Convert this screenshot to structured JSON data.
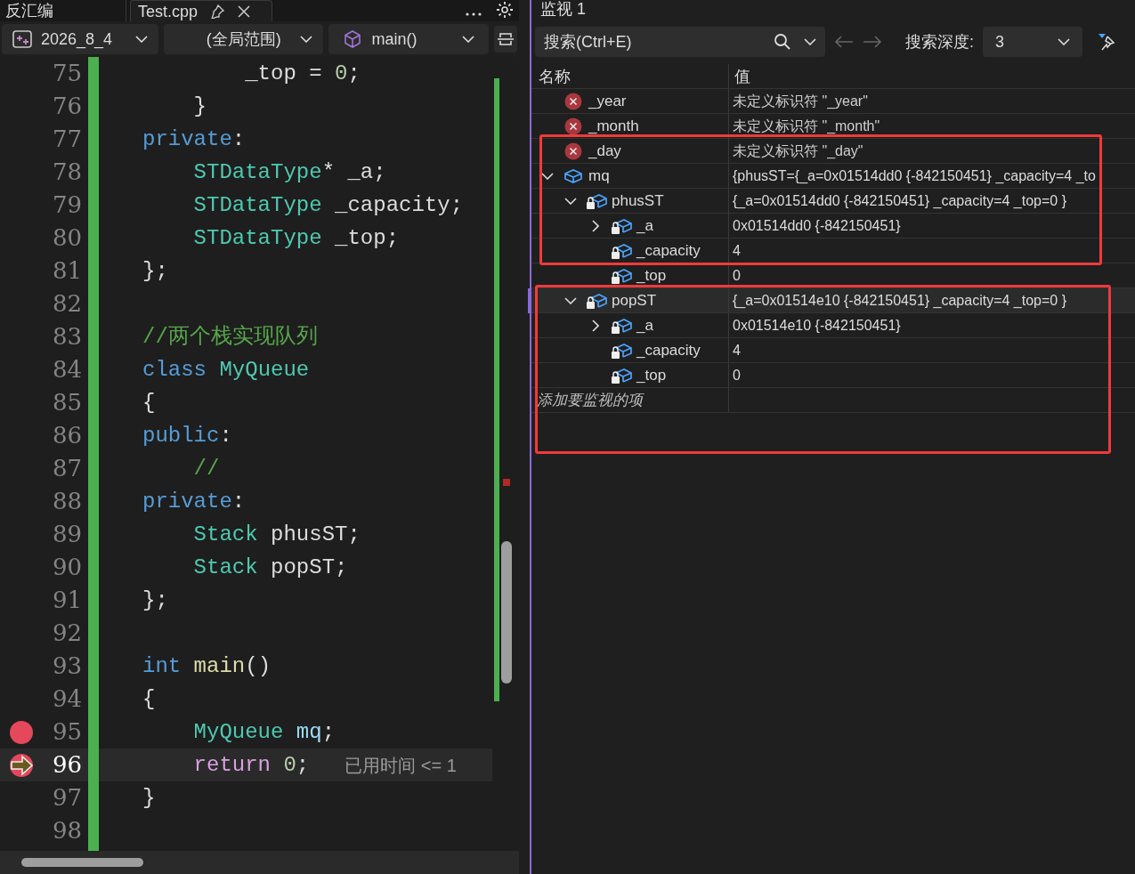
{
  "editor": {
    "tabs": [
      {
        "label": "反汇编",
        "selected": false
      },
      {
        "label": "Test.cpp",
        "selected": true,
        "pinned": true
      }
    ],
    "project": "2026_8_4",
    "scope": "(全局范围)",
    "member": "main()",
    "lines": [
      {
        "number": "75",
        "tokens": [
          {
            "kind": "plain",
            "text": "        _top = "
          },
          {
            "kind": "number",
            "text": "0"
          },
          {
            "kind": "plain",
            "text": ";"
          }
        ]
      },
      {
        "number": "76",
        "tokens": [
          {
            "kind": "plain",
            "text": "    }"
          }
        ]
      },
      {
        "number": "77",
        "tokens": [
          {
            "kind": "keyword",
            "text": "private"
          },
          {
            "kind": "plain",
            "text": ":"
          }
        ]
      },
      {
        "number": "78",
        "tokens": [
          {
            "kind": "type",
            "text": "    STDataType"
          },
          {
            "kind": "plain",
            "text": "* _a;"
          }
        ]
      },
      {
        "number": "79",
        "tokens": [
          {
            "kind": "type",
            "text": "    STDataType"
          },
          {
            "kind": "plain",
            "text": " _capacity;"
          }
        ]
      },
      {
        "number": "80",
        "tokens": [
          {
            "kind": "type",
            "text": "    STDataType"
          },
          {
            "kind": "plain",
            "text": " _top;"
          }
        ]
      },
      {
        "number": "81",
        "tokens": [
          {
            "kind": "plain",
            "text": "};"
          }
        ]
      },
      {
        "number": "82"
      },
      {
        "number": "83",
        "tokens": [
          {
            "kind": "comment",
            "text": "//两个栈实现队列"
          }
        ]
      },
      {
        "number": "84",
        "tokens": [
          {
            "kind": "keyword",
            "text": "class"
          },
          {
            "kind": "type",
            "text": " MyQueue"
          }
        ]
      },
      {
        "number": "85",
        "tokens": [
          {
            "kind": "plain",
            "text": "{"
          }
        ]
      },
      {
        "number": "86",
        "tokens": [
          {
            "kind": "keyword",
            "text": "public"
          },
          {
            "kind": "plain",
            "text": ":"
          }
        ]
      },
      {
        "number": "87",
        "tokens": [
          {
            "kind": "comment",
            "text": "    //"
          }
        ]
      },
      {
        "number": "88",
        "tokens": [
          {
            "kind": "keyword",
            "text": "private"
          },
          {
            "kind": "plain",
            "text": ":"
          }
        ]
      },
      {
        "number": "89",
        "tokens": [
          {
            "kind": "type",
            "text": "    Stack"
          },
          {
            "kind": "plain",
            "text": " phusST;"
          }
        ]
      },
      {
        "number": "90",
        "tokens": [
          {
            "kind": "type",
            "text": "    Stack"
          },
          {
            "kind": "plain",
            "text": " popST;"
          }
        ]
      },
      {
        "number": "91",
        "tokens": [
          {
            "kind": "plain",
            "text": "};"
          }
        ]
      },
      {
        "number": "92"
      },
      {
        "number": "93",
        "tokens": [
          {
            "kind": "keyword",
            "text": "int"
          },
          {
            "kind": "function",
            "text": " main"
          },
          {
            "kind": "plain",
            "text": "()"
          }
        ]
      },
      {
        "number": "94",
        "tokens": [
          {
            "kind": "plain",
            "text": "{"
          }
        ]
      },
      {
        "number": "95",
        "breakpoint": true,
        "tokens": [
          {
            "kind": "type",
            "text": "    MyQueue"
          },
          {
            "kind": "variable",
            "text": " mq"
          },
          {
            "kind": "plain",
            "text": ";"
          }
        ]
      },
      {
        "number": "96",
        "current": true,
        "hint": "已用时间 <= 1",
        "tokens": [
          {
            "kind": "control",
            "text": "    return"
          },
          {
            "kind": "number",
            "text": " 0"
          },
          {
            "kind": "plain",
            "text": ";"
          }
        ]
      },
      {
        "number": "97",
        "tokens": [
          {
            "kind": "plain",
            "text": "}"
          }
        ]
      },
      {
        "number": "98"
      }
    ]
  },
  "watch": {
    "title": "监视 1",
    "search": {
      "placeholder": "搜索(Ctrl+E)"
    },
    "depth_label": "搜索深度:",
    "depth": "3",
    "columns": [
      "名称",
      "值"
    ],
    "items": [
      {
        "name": "_year",
        "value": "未定义标识符 \"_year\"",
        "kind": "error",
        "selected": false
      },
      {
        "name": "_month",
        "value": "未定义标识符 \"_month\"",
        "kind": "error",
        "selected": false
      },
      {
        "name": "_day",
        "value": "未定义标识符 \"_day\"",
        "kind": "error",
        "selected": false
      },
      {
        "name": "mq",
        "value": "{phusST={_a=0x01514dd0 {-842150451} _capacity=4 _to",
        "kind": "object",
        "selected": false,
        "expanded": true,
        "children": [
          {
            "name": "phusST",
            "value": "{_a=0x01514dd0 {-842150451} _capacity=4 _top=0 }",
            "kind": "private",
            "selected": false,
            "expanded": true,
            "children": [
              {
                "name": "_a",
                "value": "0x01514dd0 {-842150451}",
                "kind": "private",
                "selected": false,
                "expanded": false
              },
              {
                "name": "_capacity",
                "value": "4",
                "kind": "private",
                "selected": false
              },
              {
                "name": "_top",
                "value": "0",
                "kind": "private",
                "selected": false
              }
            ]
          },
          {
            "name": "popST",
            "value": "{_a=0x01514e10 {-842150451} _capacity=4 _top=0 }",
            "kind": "private",
            "selected": true,
            "expanded": true,
            "children": [
              {
                "name": "_a",
                "value": "0x01514e10 {-842150451}",
                "kind": "private",
                "selected": false,
                "expanded": false
              },
              {
                "name": "_capacity",
                "value": "4",
                "kind": "private",
                "selected": false
              },
              {
                "name": "_top",
                "value": "0",
                "kind": "private",
                "selected": false
              }
            ]
          }
        ]
      }
    ],
    "add_placeholder": "添加要监视的项"
  },
  "annotations": [
    {
      "kind": "rectangle",
      "color": "#f03a3a"
    },
    {
      "kind": "rectangle",
      "color": "#f03a3a"
    }
  ]
}
